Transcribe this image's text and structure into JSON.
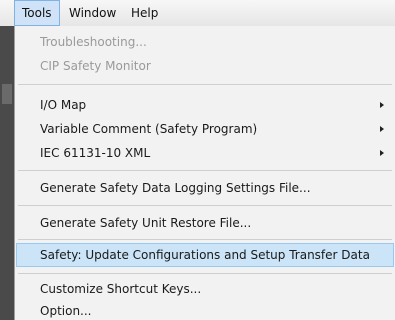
{
  "menubar": {
    "items": [
      {
        "label": "Tools"
      },
      {
        "label": "Window"
      },
      {
        "label": "Help"
      }
    ]
  },
  "tools_menu": {
    "items": [
      {
        "label": "Troubleshooting...",
        "enabled": false,
        "submenu": false
      },
      {
        "label": "CIP Safety Monitor",
        "enabled": false,
        "submenu": false
      },
      {
        "label": "I/O Map",
        "enabled": true,
        "submenu": true
      },
      {
        "label": "Variable Comment (Safety Program)",
        "enabled": true,
        "submenu": true
      },
      {
        "label": "IEC 61131-10 XML",
        "enabled": true,
        "submenu": true
      },
      {
        "label": "Generate Safety Data Logging Settings File...",
        "enabled": true,
        "submenu": false
      },
      {
        "label": "Generate Safety Unit Restore File...",
        "enabled": true,
        "submenu": false
      },
      {
        "label": "Safety: Update Configurations and Setup Transfer Data",
        "enabled": true,
        "submenu": false,
        "highlighted": true
      },
      {
        "label": "Customize Shortcut Keys...",
        "enabled": true,
        "submenu": false
      },
      {
        "label": "Option...",
        "enabled": true,
        "submenu": false
      }
    ]
  },
  "colors": {
    "highlight": "#cce4f7",
    "highlight_border": "#99c9ef",
    "disabled_text": "#9a9a9a",
    "menu_background": "#f2f2f2"
  }
}
